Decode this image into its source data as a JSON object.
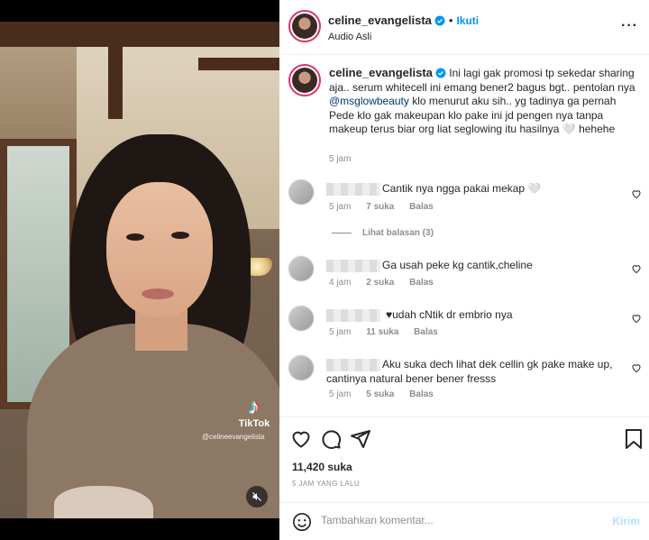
{
  "video": {
    "watermark_brand": "TikTok",
    "watermark_handle": "@celineevangelista",
    "mute_icon": "speaker-muted-icon"
  },
  "header": {
    "username": "celine_evangelista",
    "verified": true,
    "separator": "•",
    "follow_label": "Ikuti",
    "audio_label": "Audio Asli",
    "more_label": "···"
  },
  "caption": {
    "username": "celine_evangelista",
    "text_part1": " Ini lagi gak promosi tp sekedar sharing aja.. serum whitecell ini emang bener2 bagus bgt.. pentolan nya ",
    "mention": "@msglowbeauty",
    "text_part2": " klo menurut aku sih.. yg tadinya ga pernah Pede klo gak makeupan klo pake ini jd pengen nya tanpa makeup terus biar org liat seglowing itu hasilnya 🤍 hehehe",
    "time": "5 jam"
  },
  "comments": [
    {
      "text": "Cantik nya ngga pakai mekap 🤍",
      "time": "5 jam",
      "likes": "7 suka",
      "reply": "Balas"
    },
    {
      "text": "Ga usah peke kg cantik,cheline",
      "time": "4 jam",
      "likes": "2 suka",
      "reply": "Balas"
    },
    {
      "text": "♥udah cNtik dr embrio nya",
      "time": "5 jam",
      "likes": "11 suka",
      "reply": "Balas"
    },
    {
      "text": "Aku suka dech lihat dek cellin gk pake make up, cantinya natural bener bener fresss",
      "time": "5 jam",
      "likes": "5 suka",
      "reply": "Balas"
    }
  ],
  "view_replies": "Lihat balasan (3)",
  "actions": {
    "likes": "11,420 suka",
    "time": "5 JAM YANG LALU"
  },
  "comment_box": {
    "placeholder": "Tambahkan komentar...",
    "post_label": "Kirim"
  },
  "colors": {
    "accent": "#0095f6",
    "post_disabled": "#b2dffc",
    "secondary_text": "#8e8e8e"
  }
}
